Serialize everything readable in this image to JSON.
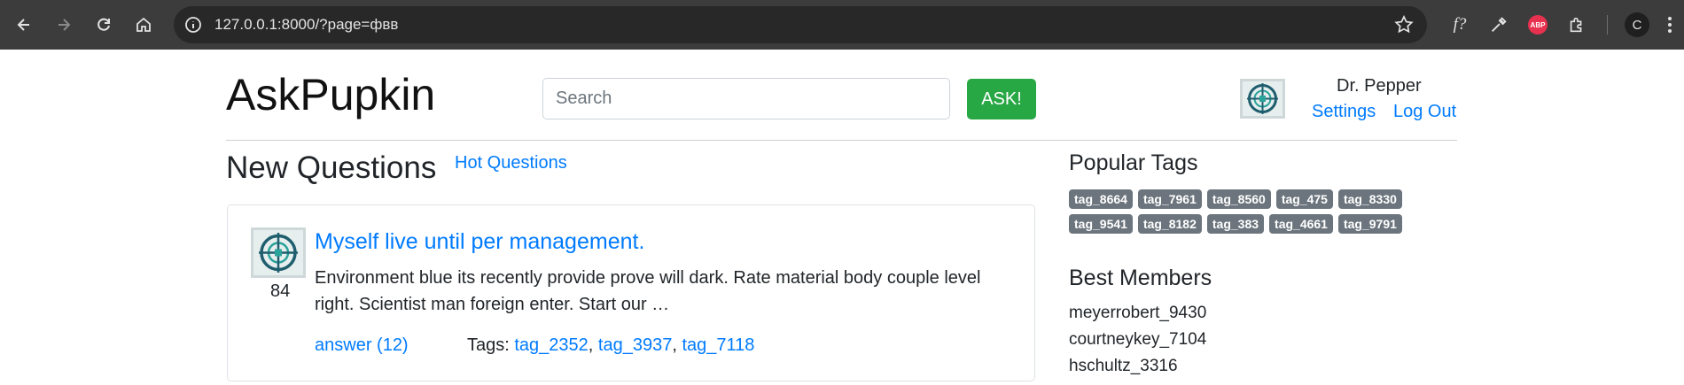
{
  "browser": {
    "url": "127.0.0.1:8000/?page=фвв",
    "profile_initial": "C",
    "extensions": [
      "f?",
      "ABP"
    ]
  },
  "header": {
    "logo": "AskPupkin",
    "search_placeholder": "Search",
    "ask_label": "ASK!",
    "user_name": "Dr. Pepper",
    "settings_label": "Settings",
    "logout_label": "Log Out"
  },
  "main": {
    "title": "New Questions",
    "hot_link": "Hot Questions",
    "questions": [
      {
        "score": "84",
        "title": "Myself live until per management.",
        "text": "Environment blue its recently provide prove will dark. Rate material body couple level right. Scientist man foreign enter. Start our …",
        "answer_label": "answer (12)",
        "tags_label": "Tags:",
        "tags": [
          "tag_2352",
          "tag_3937",
          "tag_7118"
        ]
      }
    ]
  },
  "sidebar": {
    "popular_tags_title": "Popular Tags",
    "popular_tags": [
      "tag_8664",
      "tag_7961",
      "tag_8560",
      "tag_475",
      "tag_8330",
      "tag_9541",
      "tag_8182",
      "tag_383",
      "tag_4661",
      "tag_9791"
    ],
    "best_members_title": "Best Members",
    "best_members": [
      "meyerrobert_9430",
      "courtneykey_7104",
      "hschultz_3316"
    ]
  },
  "colors": {
    "link": "#007bff",
    "ask_button": "#28a745",
    "badge": "#6c757d",
    "chrome": "#3c3c3c"
  }
}
